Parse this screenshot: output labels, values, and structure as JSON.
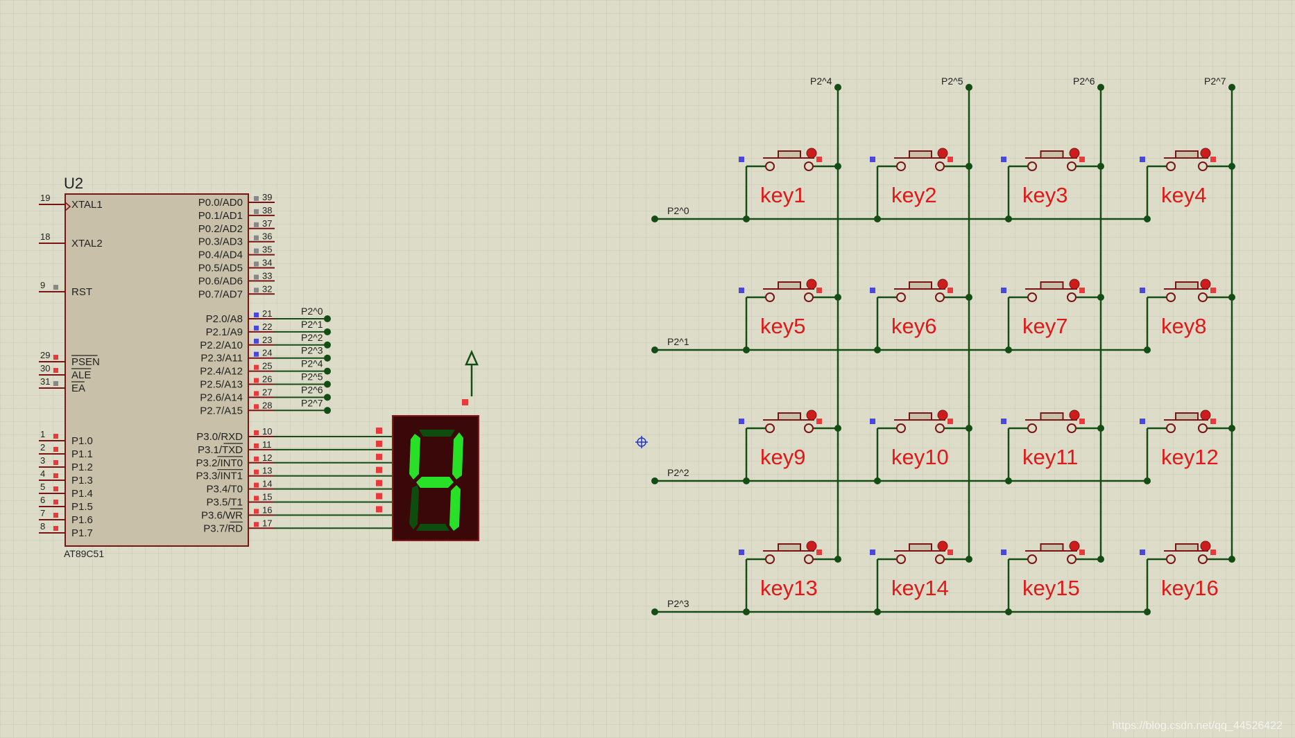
{
  "colors": {
    "background": "#dcdcc8",
    "grid": "#c9c9b6",
    "wire": "#144d14",
    "body": "#c8c0a8",
    "border": "#7a1414",
    "pin_red": "#e83a3a",
    "pin_blue": "#4848e0",
    "pin_gray": "#888888",
    "label_red": "#e01818",
    "seg_on": "#29e029",
    "seg_off": "#0e4d0e",
    "display_bg": "#3a0808"
  },
  "mcu": {
    "ref": "U2",
    "part": "AT89C51",
    "left_pins": [
      {
        "num": "19",
        "name": "XTAL1",
        "marker": "none"
      },
      {
        "num": "18",
        "name": "XTAL2",
        "marker": "none"
      },
      {
        "num": "9",
        "name": "RST",
        "marker": "gray"
      },
      {
        "num": "29",
        "name": "PSEN",
        "marker": "red",
        "overline": true
      },
      {
        "num": "30",
        "name": "ALE",
        "marker": "red",
        "overline": true
      },
      {
        "num": "31",
        "name": "EA",
        "marker": "gray",
        "overline": true
      },
      {
        "num": "1",
        "name": "P1.0",
        "marker": "red"
      },
      {
        "num": "2",
        "name": "P1.1",
        "marker": "red"
      },
      {
        "num": "3",
        "name": "P1.2",
        "marker": "red"
      },
      {
        "num": "4",
        "name": "P1.3",
        "marker": "red"
      },
      {
        "num": "5",
        "name": "P1.4",
        "marker": "red"
      },
      {
        "num": "6",
        "name": "P1.5",
        "marker": "red"
      },
      {
        "num": "7",
        "name": "P1.6",
        "marker": "red"
      },
      {
        "num": "8",
        "name": "P1.7",
        "marker": "red"
      }
    ],
    "right_pins": [
      {
        "num": "39",
        "name": "P0.0/AD0",
        "marker": "gray"
      },
      {
        "num": "38",
        "name": "P0.1/AD1",
        "marker": "gray"
      },
      {
        "num": "37",
        "name": "P0.2/AD2",
        "marker": "gray"
      },
      {
        "num": "36",
        "name": "P0.3/AD3",
        "marker": "gray"
      },
      {
        "num": "35",
        "name": "P0.4/AD4",
        "marker": "gray"
      },
      {
        "num": "34",
        "name": "P0.5/AD5",
        "marker": "gray"
      },
      {
        "num": "33",
        "name": "P0.6/AD6",
        "marker": "gray"
      },
      {
        "num": "32",
        "name": "P0.7/AD7",
        "marker": "gray"
      },
      {
        "num": "21",
        "name": "P2.0/A8",
        "marker": "blue",
        "net": "P2^0"
      },
      {
        "num": "22",
        "name": "P2.1/A9",
        "marker": "blue",
        "net": "P2^1"
      },
      {
        "num": "23",
        "name": "P2.2/A10",
        "marker": "blue",
        "net": "P2^2"
      },
      {
        "num": "24",
        "name": "P2.3/A11",
        "marker": "blue",
        "net": "P2^3"
      },
      {
        "num": "25",
        "name": "P2.4/A12",
        "marker": "red",
        "net": "P2^4"
      },
      {
        "num": "26",
        "name": "P2.5/A13",
        "marker": "red",
        "net": "P2^5"
      },
      {
        "num": "27",
        "name": "P2.6/A14",
        "marker": "red",
        "net": "P2^6"
      },
      {
        "num": "28",
        "name": "P2.7/A15",
        "marker": "red",
        "net": "P2^7"
      },
      {
        "num": "10",
        "name": "P3.0/RXD",
        "marker": "red",
        "prefix": "P3.0/",
        "over": ""
      },
      {
        "num": "11",
        "name": "P3.1/TXD",
        "marker": "red",
        "prefix": "P3.1/",
        "over": "TXD"
      },
      {
        "num": "12",
        "name": "P3.2/INT0",
        "marker": "red",
        "prefix": "P3.2/",
        "over": "INT0"
      },
      {
        "num": "13",
        "name": "P3.3/INT1",
        "marker": "red",
        "prefix": "P3.3/",
        "over": "INT1"
      },
      {
        "num": "14",
        "name": "P3.4/T0",
        "marker": "red",
        "prefix": "P3.4/",
        "over": ""
      },
      {
        "num": "15",
        "name": "P3.5/T1",
        "marker": "red",
        "prefix": "P3.5/",
        "over": ""
      },
      {
        "num": "16",
        "name": "P3.6/WR",
        "marker": "red",
        "prefix": "P3.6/",
        "over": "WR"
      },
      {
        "num": "17",
        "name": "P3.7/RD",
        "marker": "red",
        "prefix": "P3.7/",
        "over": "RD"
      }
    ]
  },
  "display": {
    "digit": "4",
    "segments_on": [
      "b",
      "c",
      "f",
      "g"
    ]
  },
  "keypad": {
    "column_nets": [
      "P2^4",
      "P2^5",
      "P2^6",
      "P2^7"
    ],
    "row_nets": [
      "P2^0",
      "P2^1",
      "P2^2",
      "P2^3"
    ],
    "keys": [
      "key1",
      "key2",
      "key3",
      "key4",
      "key5",
      "key6",
      "key7",
      "key8",
      "key9",
      "key10",
      "key11",
      "key12",
      "key13",
      "key14",
      "key15",
      "key16"
    ]
  },
  "watermark": "https://blog.csdn.net/qq_44526422"
}
